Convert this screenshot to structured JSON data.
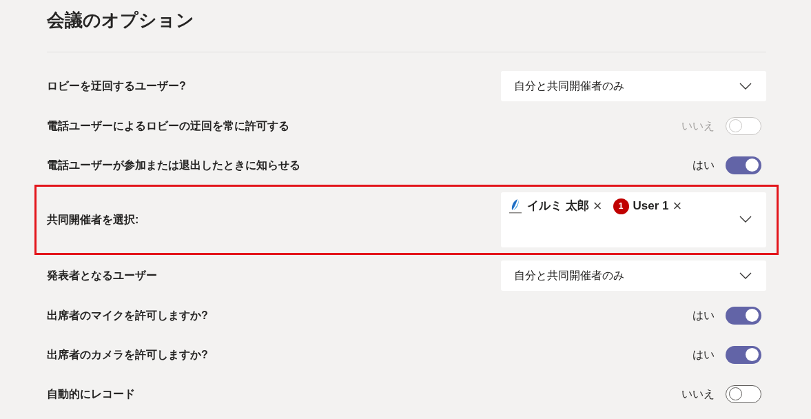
{
  "title": "会議のオプション",
  "options": [
    {
      "kind": "dropdown",
      "label": "ロビーを迂回するユーザー?",
      "value": "自分と共同開催者のみ"
    },
    {
      "kind": "toggle",
      "label": "電話ユーザーによるロビーの迂回を常に許可する",
      "state_text": "いいえ",
      "on": false,
      "disabled": true
    },
    {
      "kind": "toggle",
      "label": "電話ユーザーが参加または退出したときに知らせる",
      "state_text": "はい",
      "on": true,
      "disabled": false
    },
    {
      "kind": "people",
      "label": "共同開催者を選択:",
      "highlighted": true,
      "people": [
        {
          "kind": "logo",
          "name": "イルミ 太郎",
          "remove": "×"
        },
        {
          "kind": "badge",
          "badge": "1",
          "name": "User 1",
          "remove": "×"
        }
      ]
    },
    {
      "kind": "dropdown",
      "label": "発表者となるユーザー",
      "value": "自分と共同開催者のみ"
    },
    {
      "kind": "toggle",
      "label": "出席者のマイクを許可しますか?",
      "state_text": "はい",
      "on": true,
      "disabled": false
    },
    {
      "kind": "toggle",
      "label": "出席者のカメラを許可しますか?",
      "state_text": "はい",
      "on": true,
      "disabled": false
    },
    {
      "kind": "toggle",
      "label": "自動的にレコード",
      "state_text": "いいえ",
      "on": false,
      "disabled": false
    }
  ]
}
